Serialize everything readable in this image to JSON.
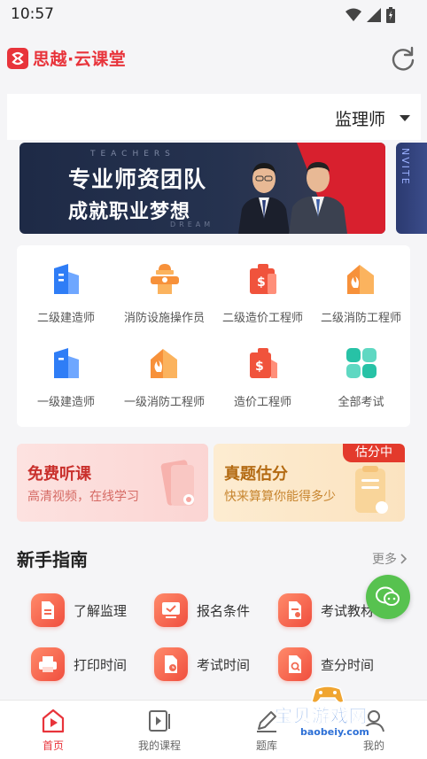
{
  "status": {
    "time": "10:57"
  },
  "header": {
    "logo_text": "思越·云课堂",
    "logo_mark": "S"
  },
  "selector": {
    "current": "监理师"
  },
  "banner": {
    "line1": "专业师资团队",
    "line2": "成就职业梦想",
    "deco_top": "TEACHERS",
    "deco_bottom": "DREAM",
    "peek_text": "NVITE"
  },
  "exams": [
    {
      "label": "二级建造师",
      "icon": "building-icon",
      "color": "#2f7df6"
    },
    {
      "label": "消防设施操作员",
      "icon": "hydrant-icon",
      "color": "#f7913a"
    },
    {
      "label": "二级造价工程师",
      "icon": "cost-bag-icon",
      "color": "#f0533c"
    },
    {
      "label": "二级消防工程师",
      "icon": "fire-house-icon",
      "color": "#f7913a"
    },
    {
      "label": "一级建造师",
      "icon": "building-icon",
      "color": "#2f7df6"
    },
    {
      "label": "一级消防工程师",
      "icon": "fire-house-icon",
      "color": "#f7913a"
    },
    {
      "label": "造价工程师",
      "icon": "cost-bag-icon",
      "color": "#f0533c"
    },
    {
      "label": "全部考试",
      "icon": "grid-icon",
      "color": "#27c2a6"
    }
  ],
  "promos": [
    {
      "title": "免费听课",
      "subtitle": "高清视频，在线学习"
    },
    {
      "title": "真题估分",
      "subtitle": "快来算算你能得多少",
      "badge": "估分中"
    }
  ],
  "guide": {
    "title": "新手指南",
    "more": "更多",
    "items": [
      {
        "label": "了解监理"
      },
      {
        "label": "报名条件"
      },
      {
        "label": "考试教材"
      },
      {
        "label": "打印时间"
      },
      {
        "label": "考试时间"
      },
      {
        "label": "查分时间"
      }
    ]
  },
  "tabs": [
    {
      "label": "首页"
    },
    {
      "label": "我的课程"
    },
    {
      "label": "题库"
    },
    {
      "label": "我的"
    }
  ],
  "watermark": {
    "text": "宝贝游戏网",
    "url": "baobeiy.com"
  }
}
